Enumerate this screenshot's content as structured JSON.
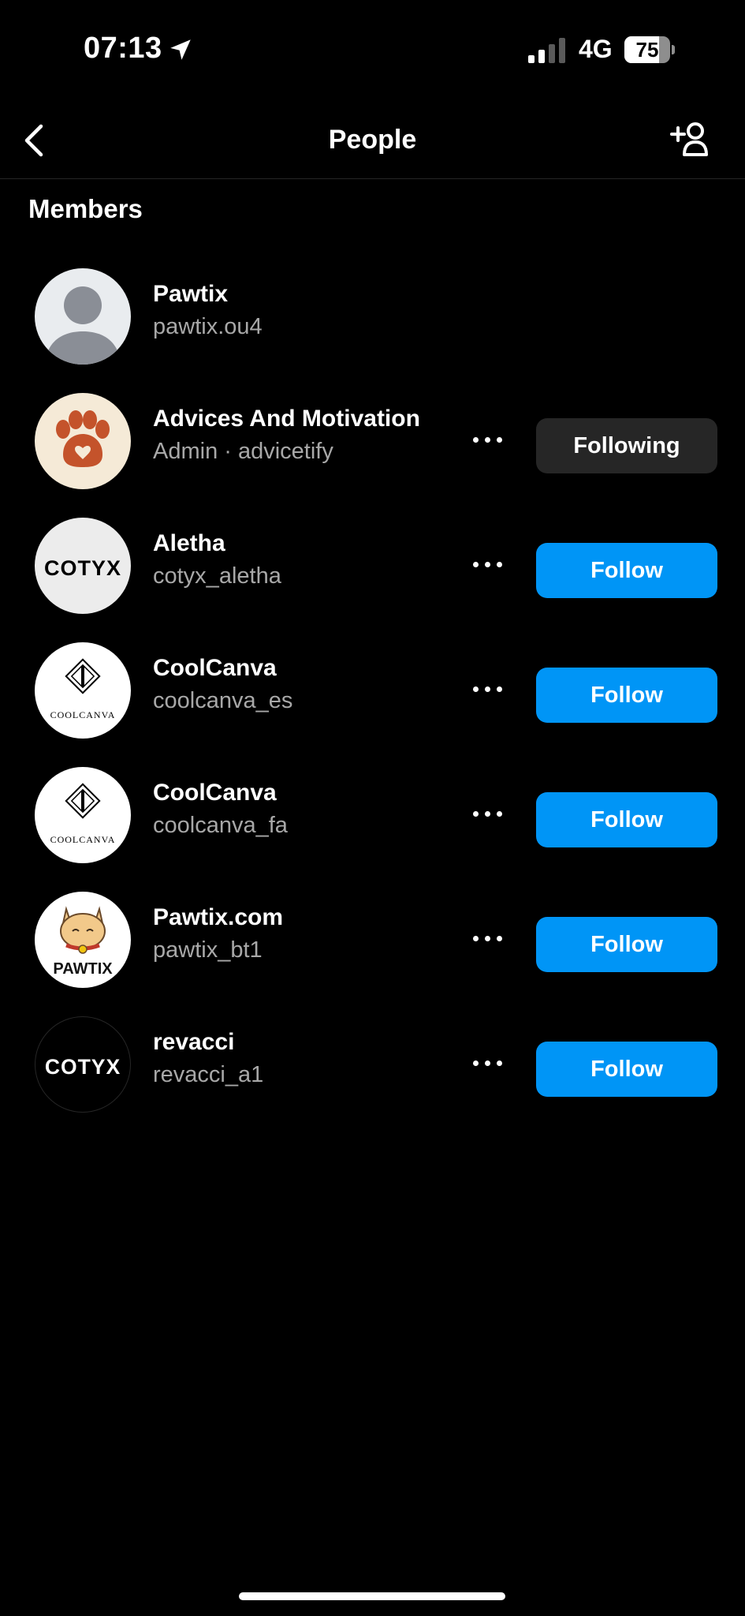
{
  "status_bar": {
    "time": "07:13",
    "network": "4G",
    "battery": "75"
  },
  "header": {
    "title": "People"
  },
  "section_title": "Members",
  "members": [
    {
      "name": "Pawtix",
      "subtitle": "pawtix.ou4",
      "avatar": "default-user-avatar"
    },
    {
      "name": "Advices And Motivation",
      "subtitle": "Admin · advicetify",
      "button": "Following",
      "avatar": "paw-print-avatar"
    },
    {
      "name": "Aletha",
      "subtitle": "cotyx_aletha",
      "button": "Follow",
      "avatar": "cotyx-logo-avatar",
      "avatar_text": "COTYX"
    },
    {
      "name": "CoolCanva",
      "subtitle": "coolcanva_es",
      "button": "Follow",
      "avatar": "coolcanva-logo-avatar",
      "avatar_text": "COOLCANVA"
    },
    {
      "name": "CoolCanva",
      "subtitle": "coolcanva_fa",
      "button": "Follow",
      "avatar": "coolcanva-logo-avatar",
      "avatar_text": "COOLCANVA"
    },
    {
      "name": "Pawtix.com",
      "subtitle": "pawtix_bt1",
      "button": "Follow",
      "avatar": "pawtix-cat-avatar",
      "avatar_text": "PAWTIX"
    },
    {
      "name": "revacci",
      "subtitle": "revacci_a1",
      "button": "Follow",
      "avatar": "cotyx-logo-avatar",
      "avatar_text": "COTYX"
    }
  ],
  "colors": {
    "background": "#000000",
    "follow_button": "#0095f6",
    "following_button": "#262626",
    "secondary_text": "#a8a8a8"
  }
}
